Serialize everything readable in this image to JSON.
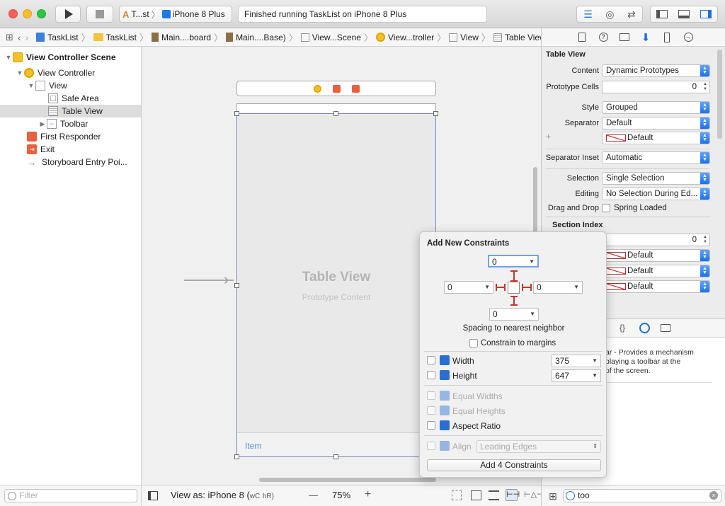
{
  "toolbar": {
    "scheme_name": "T...st",
    "device_name": "iPhone 8 Plus",
    "status_text": "Finished running TaskList on iPhone 8 Plus"
  },
  "jumpbar": {
    "items": [
      "TaskList",
      "TaskList",
      "Main....board",
      "Main....Base)",
      "View...Scene",
      "View...troller",
      "View",
      "Table View"
    ]
  },
  "navigator": {
    "rows": [
      {
        "label": "View Controller Scene"
      },
      {
        "label": "View Controller"
      },
      {
        "label": "View"
      },
      {
        "label": "Safe Area"
      },
      {
        "label": "Table View"
      },
      {
        "label": "Toolbar"
      },
      {
        "label": "First Responder"
      },
      {
        "label": "Exit"
      },
      {
        "label": "Storyboard Entry Poi..."
      }
    ],
    "filter_placeholder": "Filter"
  },
  "canvas": {
    "table_title": "Table View",
    "table_subtitle": "Prototype Content",
    "toolbar_item": "Item",
    "view_as": "View as: iPhone 8 (",
    "size_class_w": "wC",
    "size_class_h": "hR)",
    "zoom_minus": "—",
    "zoom": "75%",
    "zoom_plus": "+"
  },
  "inspector": {
    "section_title": "Table View",
    "content_label": "Content",
    "content_value": "Dynamic Prototypes",
    "prototype_cells_label": "Prototype Cells",
    "prototype_cells_value": "0",
    "style_label": "Style",
    "style_value": "Grouped",
    "separator_label": "Separator",
    "separator_value": "Default",
    "separator_color_value": "Default",
    "plus": "+",
    "separator_inset_label": "Separator Inset",
    "separator_inset_value": "Automatic",
    "selection_label": "Selection",
    "selection_value": "Single Selection",
    "editing_label": "Editing",
    "editing_value": "No Selection During Ed...",
    "drag_drop_label": "Drag and Drop",
    "drag_drop_value": "Spring Loaded",
    "section_index_title": "Section Index",
    "section_index_value": "0",
    "index_colors": [
      "Default",
      "Default",
      "Default"
    ],
    "library_text_line1": "ar - Provides a mechanism",
    "library_text_line2": "playing a toolbar at the",
    "library_text_line3": "of the screen.",
    "library_search_value": "too"
  },
  "popover": {
    "title": "Add New Constraints",
    "top_value": "0",
    "left_value": "0",
    "right_value": "0",
    "bottom_value": "0",
    "spacing_label": "Spacing to nearest neighbor",
    "constrain_margins": "Constrain to margins",
    "width_label": "Width",
    "width_value": "375",
    "height_label": "Height",
    "height_value": "647",
    "equal_widths": "Equal Widths",
    "equal_heights": "Equal Heights",
    "aspect_ratio": "Aspect Ratio",
    "align_label": "Align",
    "align_value": "Leading Edges",
    "add_button": "Add 4 Constraints"
  },
  "colors": {
    "accent": "#1d6ff2",
    "constraint_red": "#c0392b",
    "selection_gray": "#dcdcdc"
  }
}
